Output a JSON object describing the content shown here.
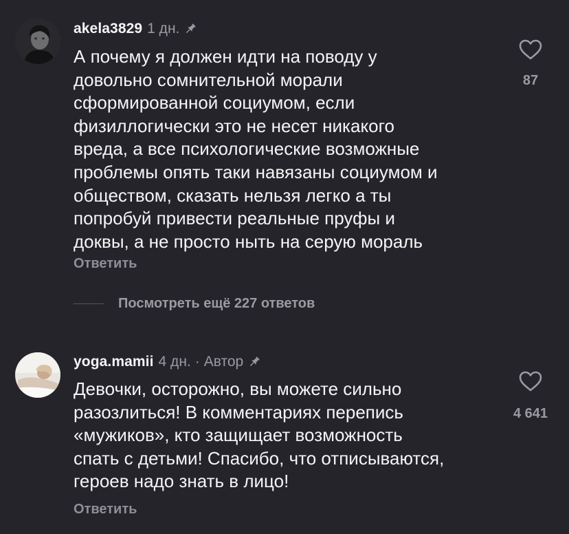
{
  "comments": [
    {
      "username": "akela3829",
      "time": "1 дн.",
      "author_badge": "",
      "icon": "pin-icon",
      "text_lines": [
        "А почему я должен идти на поводу у",
        "довольно сомнительной морали",
        "сформированной социумом, если",
        "физиллогически это не несет никакого",
        "вреда, а все психологические возможные",
        "проблемы опять таки навязаны социумом и",
        "обществом, сказать нельзя легко а ты",
        "попробуй привести реальные пруфы и",
        "доквы, а не просто ныть на серую мораль"
      ],
      "reply_label": "Ответить",
      "like_icon": "heart-outline-icon",
      "like_count": "87"
    },
    {
      "username": "yoga.mamii",
      "time": "4 дн.",
      "separator": "·",
      "author_badge": "Автор",
      "icon": "pin-icon",
      "text_lines": [
        "Девочки, осторожно, вы можете сильно",
        "разозлиться! В комментариях перепись",
        "«мужиков», кто защищает возможность",
        "спать с детьми! Спасибо, что отписываются,",
        "героев надо знать в лицо!"
      ],
      "reply_label": "Ответить",
      "like_icon": "heart-outline-icon",
      "like_count": "4 641"
    }
  ],
  "more_replies_label": "Посмотреть ещё 227 ответов",
  "colors": {
    "background": "#24242a",
    "primary_text": "#f5f5f7",
    "secondary_text": "#9a9aa2"
  }
}
